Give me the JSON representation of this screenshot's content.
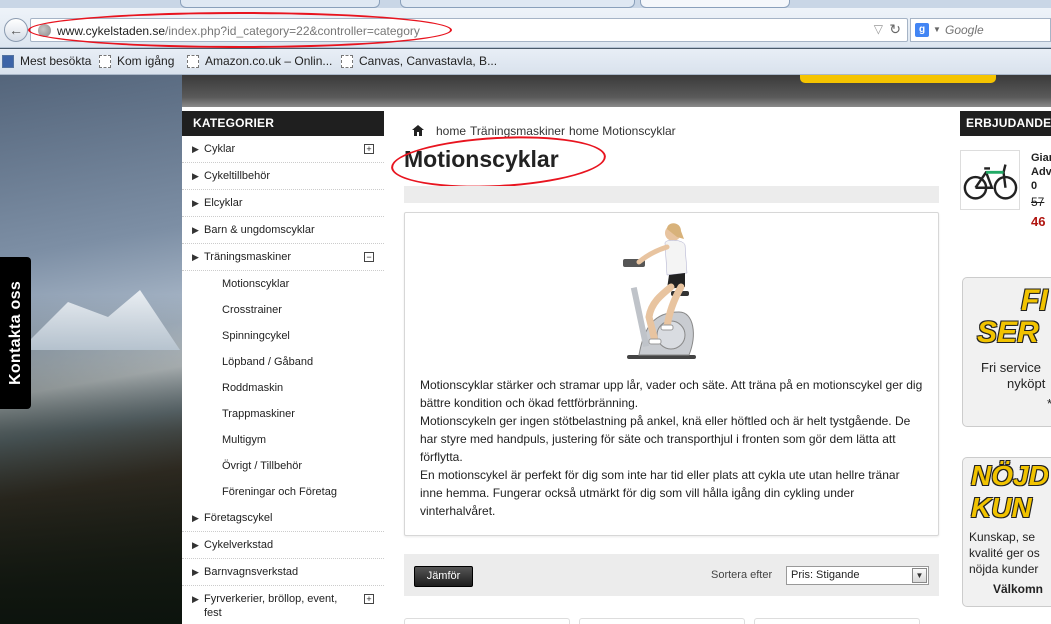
{
  "browser": {
    "url_host": "www.cykelstaden.se",
    "url_path": "/index.php?id_category=22&controller=category",
    "search_placeholder": "Google",
    "search_engine_letter": "g",
    "bookmarks": [
      {
        "label": "Mest besökta"
      },
      {
        "label": "Kom igång"
      },
      {
        "label": "Amazon.co.uk – Onlin..."
      },
      {
        "label": "Canvas, Canvastavla, B..."
      }
    ]
  },
  "sidebar": {
    "title": "KATEGORIER",
    "categories": [
      {
        "label": "Cyklar",
        "toggle": "+"
      },
      {
        "label": "Cykeltillbehör"
      },
      {
        "label": "Elcyklar"
      },
      {
        "label": "Barn & ungdomscyklar"
      },
      {
        "label": "Träningsmaskiner",
        "toggle": "−"
      },
      {
        "label": "Företagscykel"
      },
      {
        "label": "Cykelverkstad"
      },
      {
        "label": "Barnvagnsverkstad"
      },
      {
        "label": "Fyrverkerier, bröllop, event, fest",
        "toggle": "+"
      }
    ],
    "subcategories": [
      {
        "label": "Motionscyklar"
      },
      {
        "label": "Crosstrainer"
      },
      {
        "label": "Spinningcykel"
      },
      {
        "label": "Löpband / Gåband"
      },
      {
        "label": "Roddmaskin"
      },
      {
        "label": "Trappmaskiner"
      },
      {
        "label": "Multigym"
      },
      {
        "label": "Övrigt / Tillbehör"
      },
      {
        "label": "Föreningar och Företag"
      }
    ]
  },
  "breadcrumb": {
    "home": "home",
    "parent": "Träningsmaskiner",
    "current": "home Motionscyklar"
  },
  "page_title": "Motionscyklar",
  "description": {
    "paragraphs": [
      "Motionscyklar stärker och stramar upp lår, vader och säte. Att träna på en motionscykel ger dig bättre kondition och ökad fettförbränning.",
      "Motionscykeln ger ingen stötbelastning på ankel, knä eller höftled och är helt tystgående. De har styre med handpuls, justering för säte och transporthjul i fronten som gör dem lätta att förflytta.",
      "En motionscykel är perfekt för dig som inte har tid eller plats att cykla ute utan hellre tränar inne hemma. Fungerar också utmärkt för dig som vill hålla igång din cykling under vinterhalvåret."
    ]
  },
  "toolbar": {
    "compare_label": "Jämför",
    "sort_label": "Sortera efter",
    "sort_value": "Pris: Stigande"
  },
  "offers": {
    "title": "ERBJUDANDEN",
    "product_name_lines": [
      "Gian",
      "Adv",
      "0"
    ],
    "old_price": "57",
    "new_price": "46"
  },
  "promo1": {
    "big1": "FI",
    "big2": "SER",
    "line1": "Fri service",
    "line2": "nyköpt",
    "line3": "*"
  },
  "promo2": {
    "big1": "NÖJD",
    "big2": "KUN",
    "line1": "Kunskap, se",
    "line2": "kvalité ger os",
    "line3": "nöjda kunder",
    "line4": "Välkomn"
  },
  "contact_tab": "Kontakta oss",
  "colors": {
    "dark_header": "#1f1f1f",
    "accent_red": "#e8141f",
    "price_red": "#b0140f",
    "promo_yellow": "#f1c300"
  }
}
